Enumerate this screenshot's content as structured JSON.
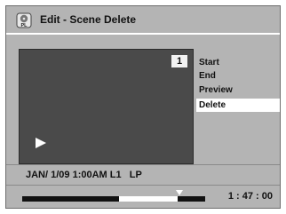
{
  "title_bar": {
    "icon_name": "pl-icon",
    "icon_label": "PL",
    "title": "Edit - Scene Delete"
  },
  "preview": {
    "chapter_number": "1",
    "play_icon": "play-icon"
  },
  "menu": {
    "items": [
      {
        "label": "Start",
        "selected": false
      },
      {
        "label": "End",
        "selected": false
      },
      {
        "label": "Preview",
        "selected": false
      },
      {
        "label": "Delete",
        "selected": true
      }
    ]
  },
  "info": {
    "recording_info": "JAN/ 1/09 1:00AM L1   LP"
  },
  "progress": {
    "segment_start_fraction": 0.53,
    "segment_end_fraction": 0.85,
    "marker_fraction": 0.86,
    "time": "1 : 47 : 00"
  },
  "colors": {
    "background": "#b4b4b4",
    "preview_bg": "#4a4a4a",
    "selected_bg": "#ffffff",
    "text": "#111111"
  }
}
